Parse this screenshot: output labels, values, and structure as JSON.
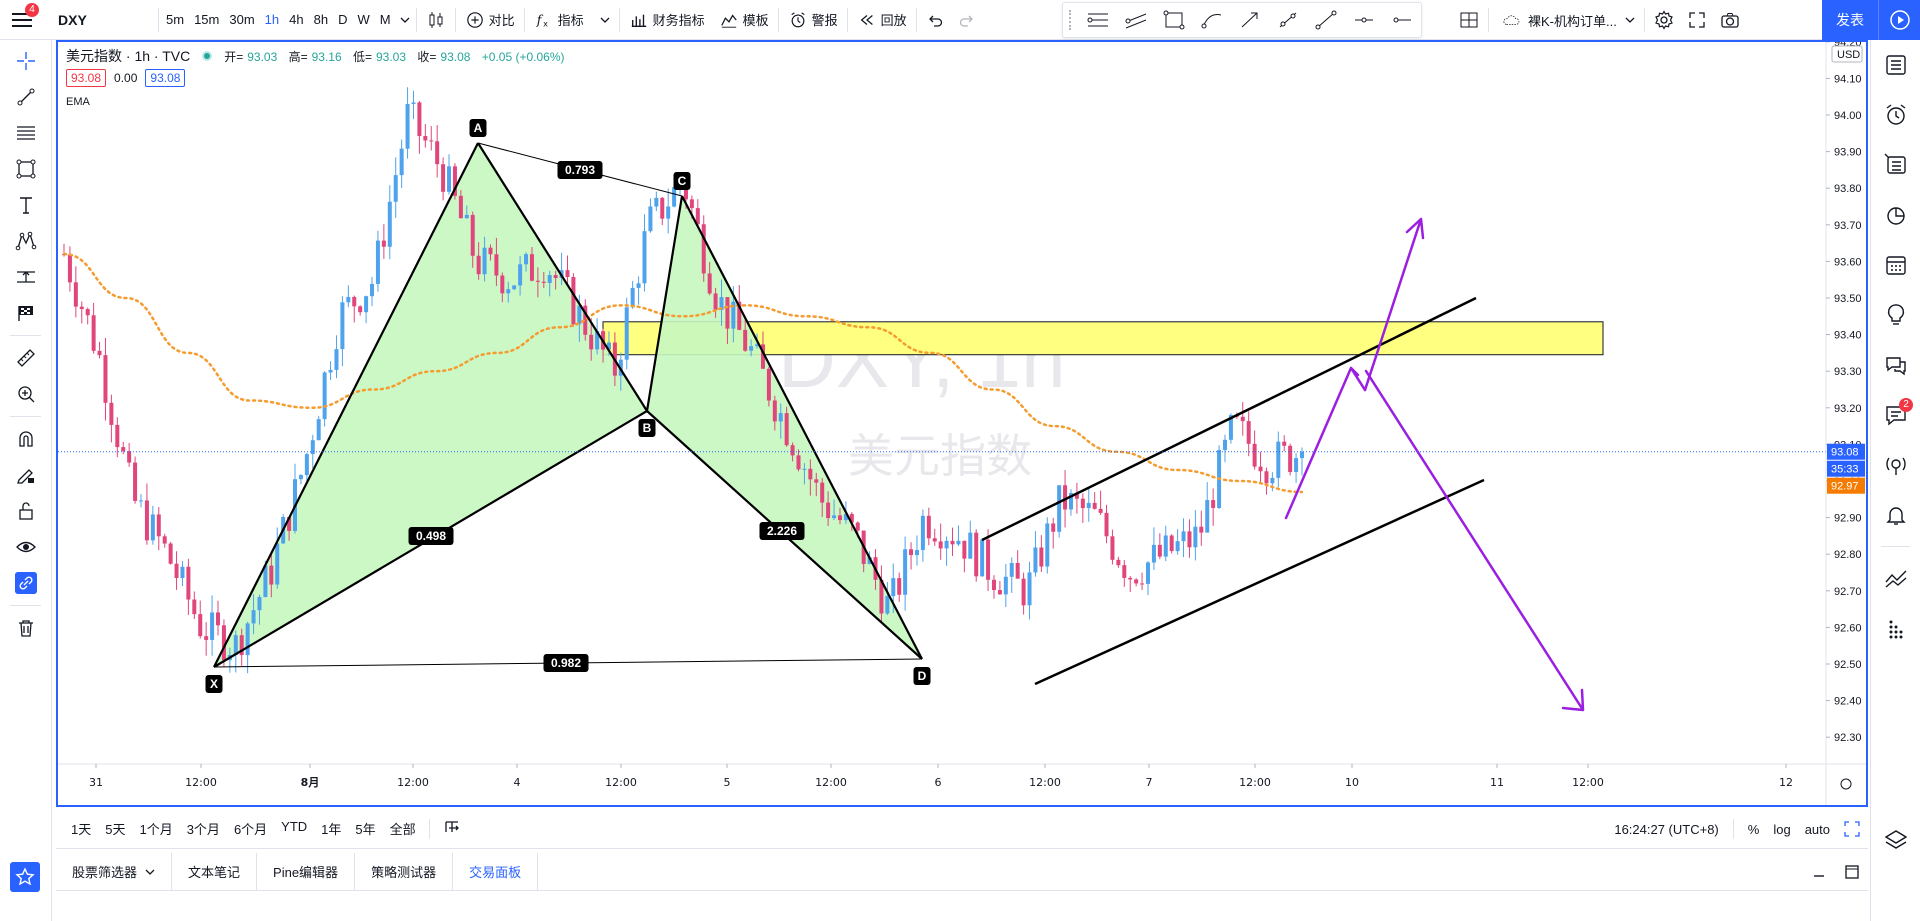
{
  "topbar": {
    "notification_count": "4",
    "symbol": "DXY",
    "timeframes": [
      "5m",
      "15m",
      "30m",
      "1h",
      "4h",
      "8h",
      "D",
      "W",
      "M"
    ],
    "active_timeframe": "1h",
    "compare_label": "对比",
    "indicators_label": "指标",
    "financials_label": "财务指标",
    "templates_label": "模板",
    "alert_label": "警报",
    "replay_label": "回放",
    "layout_name": "裸K-机构订单...",
    "publish_label": "发表"
  },
  "legend": {
    "title": "美元指数 · 1h · TVC",
    "open_label": "开=",
    "open": "93.03",
    "high_label": "高=",
    "high": "93.16",
    "low_label": "低=",
    "low": "93.03",
    "close_label": "收=",
    "close": "93.08",
    "change": "+0.05 (+0.06%)",
    "bid": "93.08",
    "spread": "0.00",
    "ask": "93.08",
    "ema_label": "EMA"
  },
  "watermark": {
    "symbol": "DXY, 1h",
    "name": "美元指数"
  },
  "price_axis": {
    "currency": "USD",
    "ticks": [
      "94.20",
      "94.10",
      "94.00",
      "93.90",
      "93.80",
      "93.70",
      "93.60",
      "93.50",
      "93.40",
      "93.30",
      "93.20",
      "93.10",
      "93.00",
      "92.90",
      "92.80",
      "92.70",
      "92.60",
      "92.50",
      "92.40",
      "92.30"
    ],
    "last_price": "93.08",
    "countdown": "35:33",
    "ema_value": "92.97"
  },
  "time_axis": {
    "ticks": [
      "31",
      "12:00",
      "8月",
      "12:00",
      "4",
      "12:00",
      "5",
      "12:00",
      "6",
      "12:00",
      "7",
      "12:00",
      "10",
      "11",
      "12:00",
      "12"
    ]
  },
  "pattern": {
    "points": [
      "X",
      "A",
      "B",
      "C",
      "D"
    ],
    "ratios": {
      "xb": "0.498",
      "ac": "0.793",
      "bd": "2.226",
      "xd": "0.982"
    }
  },
  "colors": {
    "accent": "#2962ff",
    "up": "#4ea3ec",
    "down": "#e0457b",
    "ema": "#f59b2f",
    "zone": "#ffff80",
    "pattern_fill": "#c7f7c0",
    "arrow": "#9a1fe0"
  },
  "chart_data": {
    "type": "candlestick",
    "title": "",
    "x": [
      "31 12:00",
      "8月",
      "8月 12:00",
      "4",
      "4 12:00",
      "5",
      "5 12:00",
      "6",
      "6 12:00",
      "7",
      "7 12:00"
    ],
    "price_range": [
      92.25,
      94.25
    ],
    "close_path": [
      93.62,
      93.35,
      92.95,
      92.8,
      92.6,
      92.55,
      92.75,
      93.05,
      93.45,
      93.55,
      94.0,
      93.85,
      93.6,
      93.55,
      93.6,
      93.45,
      93.3,
      93.7,
      93.82,
      93.5,
      93.35,
      93.15,
      92.95,
      92.85,
      92.65,
      92.9,
      92.85,
      92.75,
      92.7,
      92.95,
      92.9,
      92.75,
      92.8,
      92.85,
      93.15,
      93.05,
      93.08
    ],
    "ema": [
      93.62,
      93.5,
      93.35,
      93.22,
      93.2,
      93.25,
      93.3,
      93.35,
      93.42,
      93.48,
      93.45,
      93.48,
      93.45,
      93.42,
      93.35,
      93.25,
      93.15,
      93.08,
      93.03,
      93.0,
      92.97
    ],
    "last_price": 93.08
  },
  "rangebar": {
    "ranges": [
      "1天",
      "5天",
      "1个月",
      "3个月",
      "6个月",
      "YTD",
      "1年",
      "5年",
      "全部"
    ],
    "clock": "16:24:27 (UTC+8)",
    "percent": "%",
    "log": "log",
    "auto": "auto"
  },
  "bottom_tabs": [
    "股票筛选器",
    "文本笔记",
    "Pine编辑器",
    "策略测试器",
    "交易面板"
  ],
  "active_bottom_tab": "交易面板",
  "right_badge": "2"
}
